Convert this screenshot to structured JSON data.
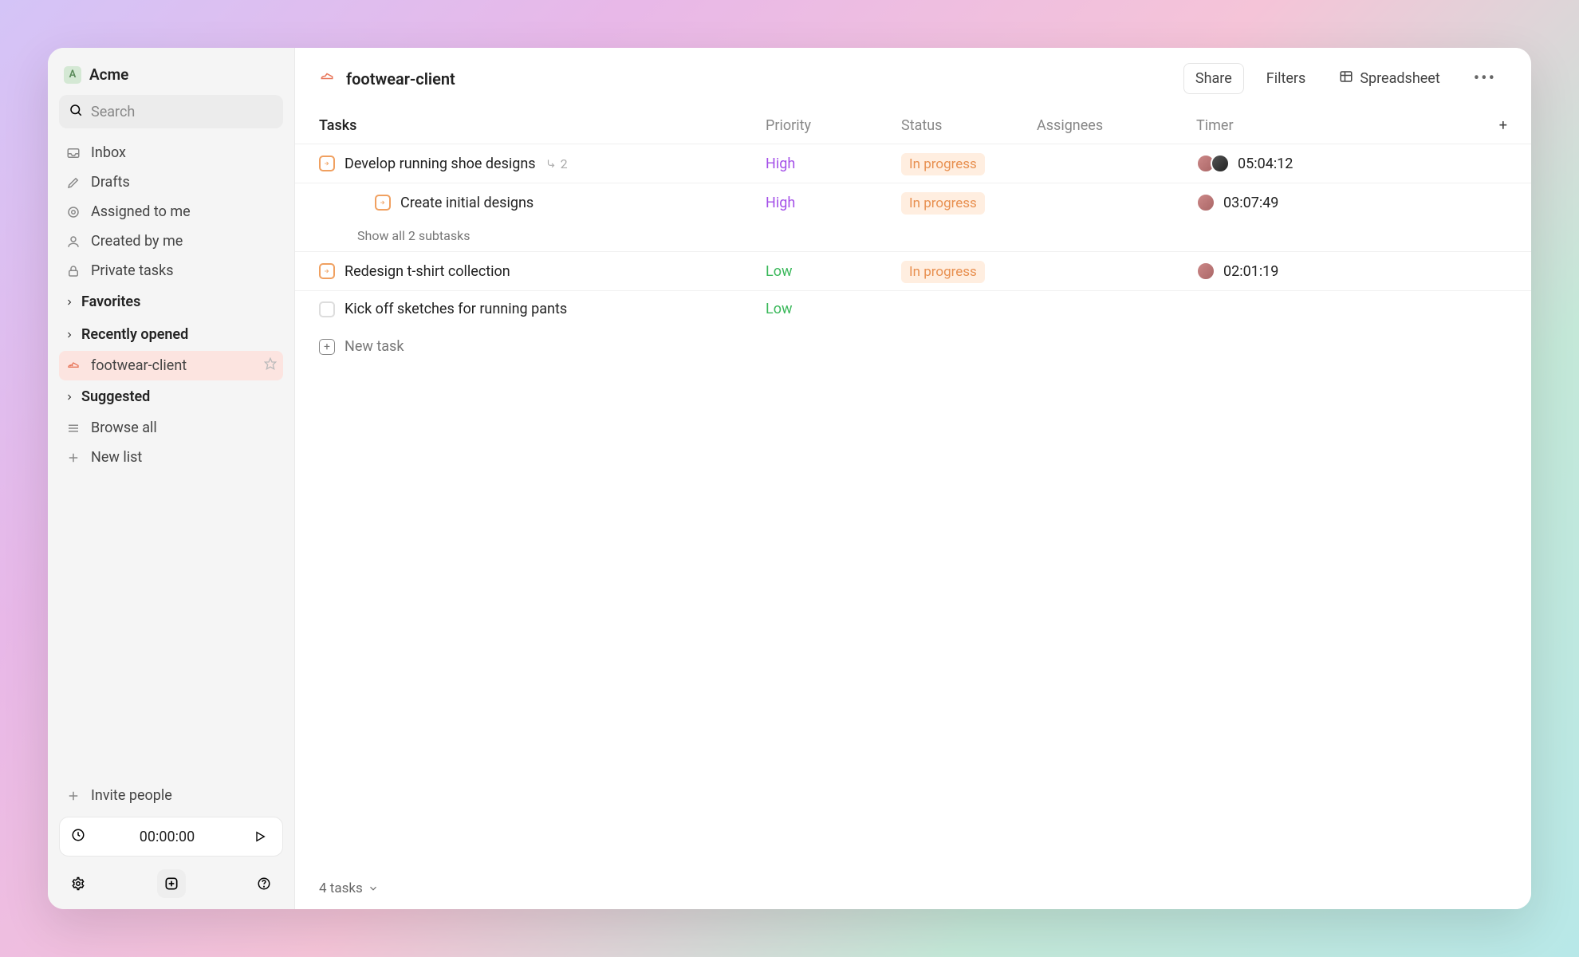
{
  "workspace": {
    "initial": "A",
    "name": "Acme"
  },
  "search": {
    "placeholder": "Search"
  },
  "nav": {
    "inbox": "Inbox",
    "drafts": "Drafts",
    "assigned": "Assigned to me",
    "created": "Created by me",
    "private": "Private tasks"
  },
  "sections": {
    "favorites": "Favorites",
    "recently": "Recently opened",
    "suggested": "Suggested"
  },
  "lists": {
    "footwear": "footwear-client"
  },
  "browse_all": "Browse all",
  "new_list": "New list",
  "invite": "Invite people",
  "timer": {
    "value": "00:00:00"
  },
  "header": {
    "title": "footwear-client",
    "share": "Share",
    "filters": "Filters",
    "view": "Spreadsheet"
  },
  "columns": {
    "tasks": "Tasks",
    "priority": "Priority",
    "status": "Status",
    "assignees": "Assignees",
    "timer": "Timer"
  },
  "tasks": [
    {
      "title": "Develop running shoe designs",
      "priority": "High",
      "status": "In progress",
      "timer": "05:04:12",
      "subcount": "2",
      "assignees": 2
    },
    {
      "title": "Create initial designs",
      "priority": "High",
      "status": "In progress",
      "timer": "03:07:49",
      "assignees": 1,
      "sub": true
    },
    {
      "title": "Redesign t-shirt collection",
      "priority": "Low",
      "status": "In progress",
      "timer": "02:01:19",
      "assignees": 1
    },
    {
      "title": "Kick off sketches for running pants",
      "priority": "Low",
      "status": "",
      "timer": "",
      "assignees": 0,
      "unchecked": true
    }
  ],
  "show_all": "Show all 2 subtasks",
  "new_task": "New task",
  "footer": {
    "count": "4 tasks"
  }
}
